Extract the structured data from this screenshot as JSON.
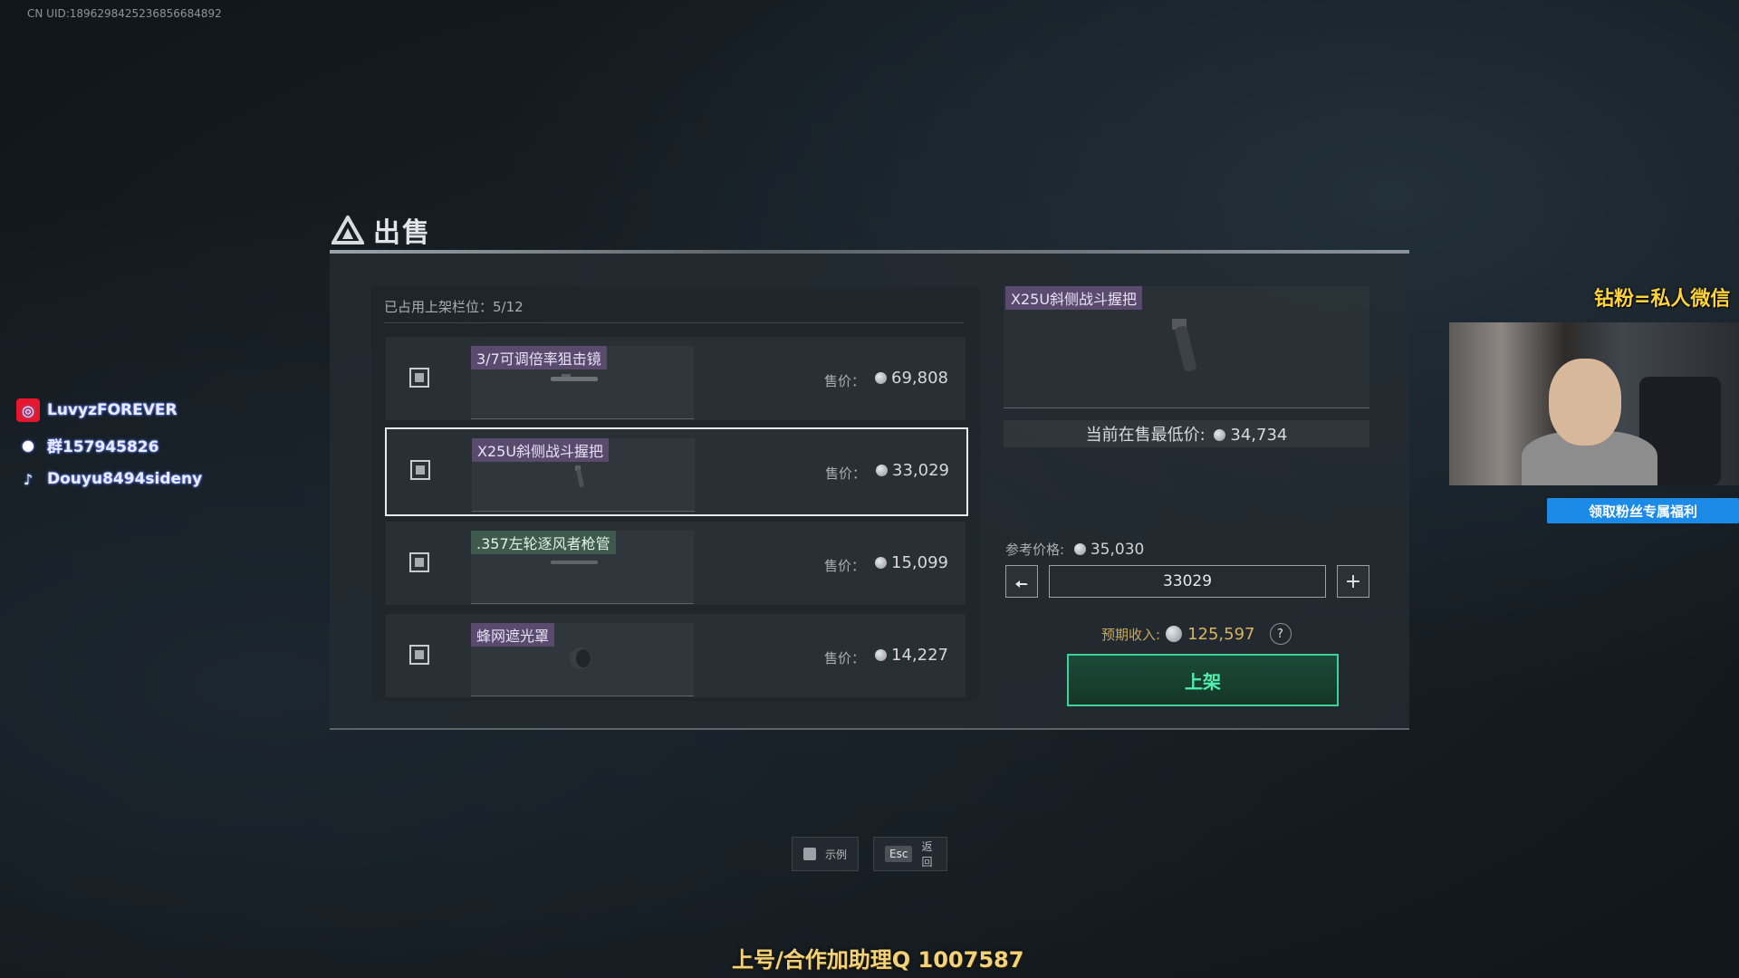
{
  "uid": "CN UID:1896298425236856684892",
  "social": {
    "weibo": "LuvyzFOREVER",
    "qq": "群157945826",
    "douyin": "Douyu8494sideny"
  },
  "dialog": {
    "title": "出售",
    "slots": "已占用上架栏位：5/12",
    "price_label": "售价：",
    "items": [
      {
        "name": "3/7可调倍率狙击镜",
        "price": "69,808",
        "selected": false
      },
      {
        "name": "X25U斜侧战斗握把",
        "price": "33,029",
        "selected": true
      },
      {
        "name": ".357左轮逐风者枪管",
        "price": "15,099",
        "selected": false
      },
      {
        "name": "蜂网遮光罩",
        "price": "14,227",
        "selected": false
      }
    ],
    "detail": {
      "name": "X25U斜侧战斗握把",
      "lowest_label": "当前在售最低价:",
      "lowest_value": "34,734",
      "ref_label": "参考价格:",
      "ref_value": "35,030",
      "quantity": "33029",
      "income_label": "预期收入:",
      "income_value": "125,597",
      "help": "?",
      "list_button": "上架"
    }
  },
  "hints": {
    "example_label": "示例",
    "esc_key": "Esc",
    "back_label": "返回"
  },
  "stream": {
    "promo": "钻粉=私人微信",
    "fan_button": "领取粉丝专属福利",
    "bottom_ad": "上号/合作加助理Q 1007587"
  },
  "colors": {
    "accent_green": "#3fd39a",
    "tag_purple": "#5a4a6e",
    "tag_green": "#3d5a4d",
    "income_gold": "#d8b463"
  }
}
